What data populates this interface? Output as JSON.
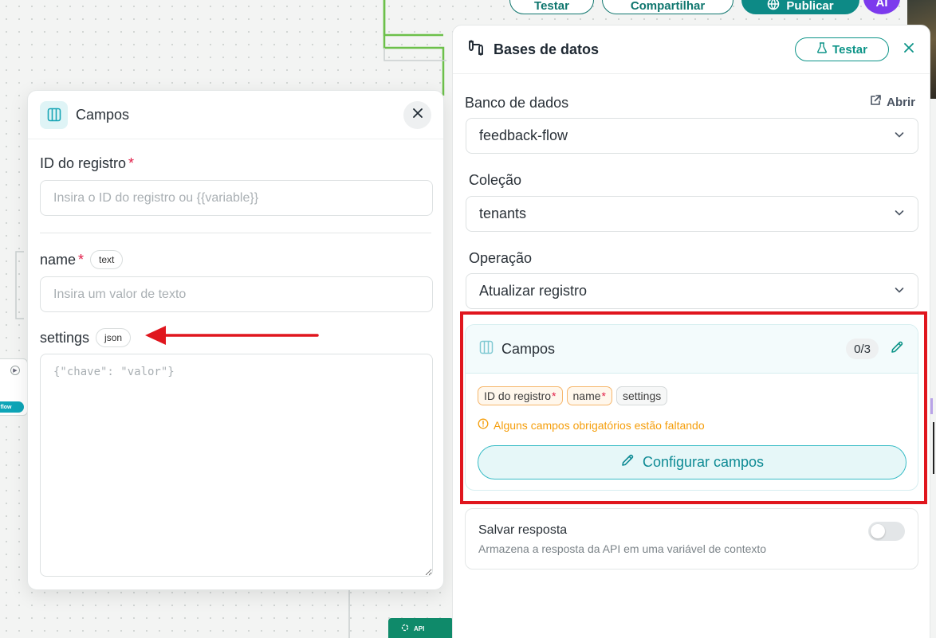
{
  "top_bar": {
    "test_label": "Testar",
    "share_label": "Compartilhar",
    "publish_label": "Publicar",
    "avatar_initials": "AI"
  },
  "canvas": {
    "api_chip_label": "API",
    "node_pill_label": "flow"
  },
  "campos_panel": {
    "title": "Campos",
    "fields": [
      {
        "label": "ID do registro",
        "required": true,
        "type": "",
        "placeholder": "Insira o ID do registro ou {{variable}}",
        "value": ""
      },
      {
        "label": "name",
        "required": true,
        "type": "text",
        "placeholder": "Insira um valor de texto",
        "value": ""
      },
      {
        "label": "settings",
        "required": false,
        "type": "json",
        "placeholder": "{\"chave\": \"valor\"}",
        "value": ""
      }
    ],
    "required_mark": "*"
  },
  "database_panel": {
    "title": "Bases de datos",
    "test_button": "Testar",
    "database": {
      "label": "Banco de dados",
      "open_link": "Abrir",
      "selected": "feedback-flow"
    },
    "collection": {
      "label": "Coleção",
      "selected": "tenants"
    },
    "operation": {
      "label": "Operação",
      "selected": "Atualizar registro"
    },
    "fields_card": {
      "title": "Campos",
      "count": "0/3",
      "tags": [
        {
          "label": "ID do registro",
          "required": true
        },
        {
          "label": "name",
          "required": true
        },
        {
          "label": "settings",
          "required": false
        }
      ],
      "warning": "Alguns campos obrigatórios estão faltando",
      "configure_button": "Configurar campos"
    },
    "save_response": {
      "title": "Salvar resposta",
      "description": "Armazena a resposta da API em uma variável de contexto",
      "enabled": false
    }
  },
  "colors": {
    "accent": "#0d9488",
    "warning": "#f59e0b",
    "required": "#e11d48",
    "annotation": "#e0161e"
  }
}
